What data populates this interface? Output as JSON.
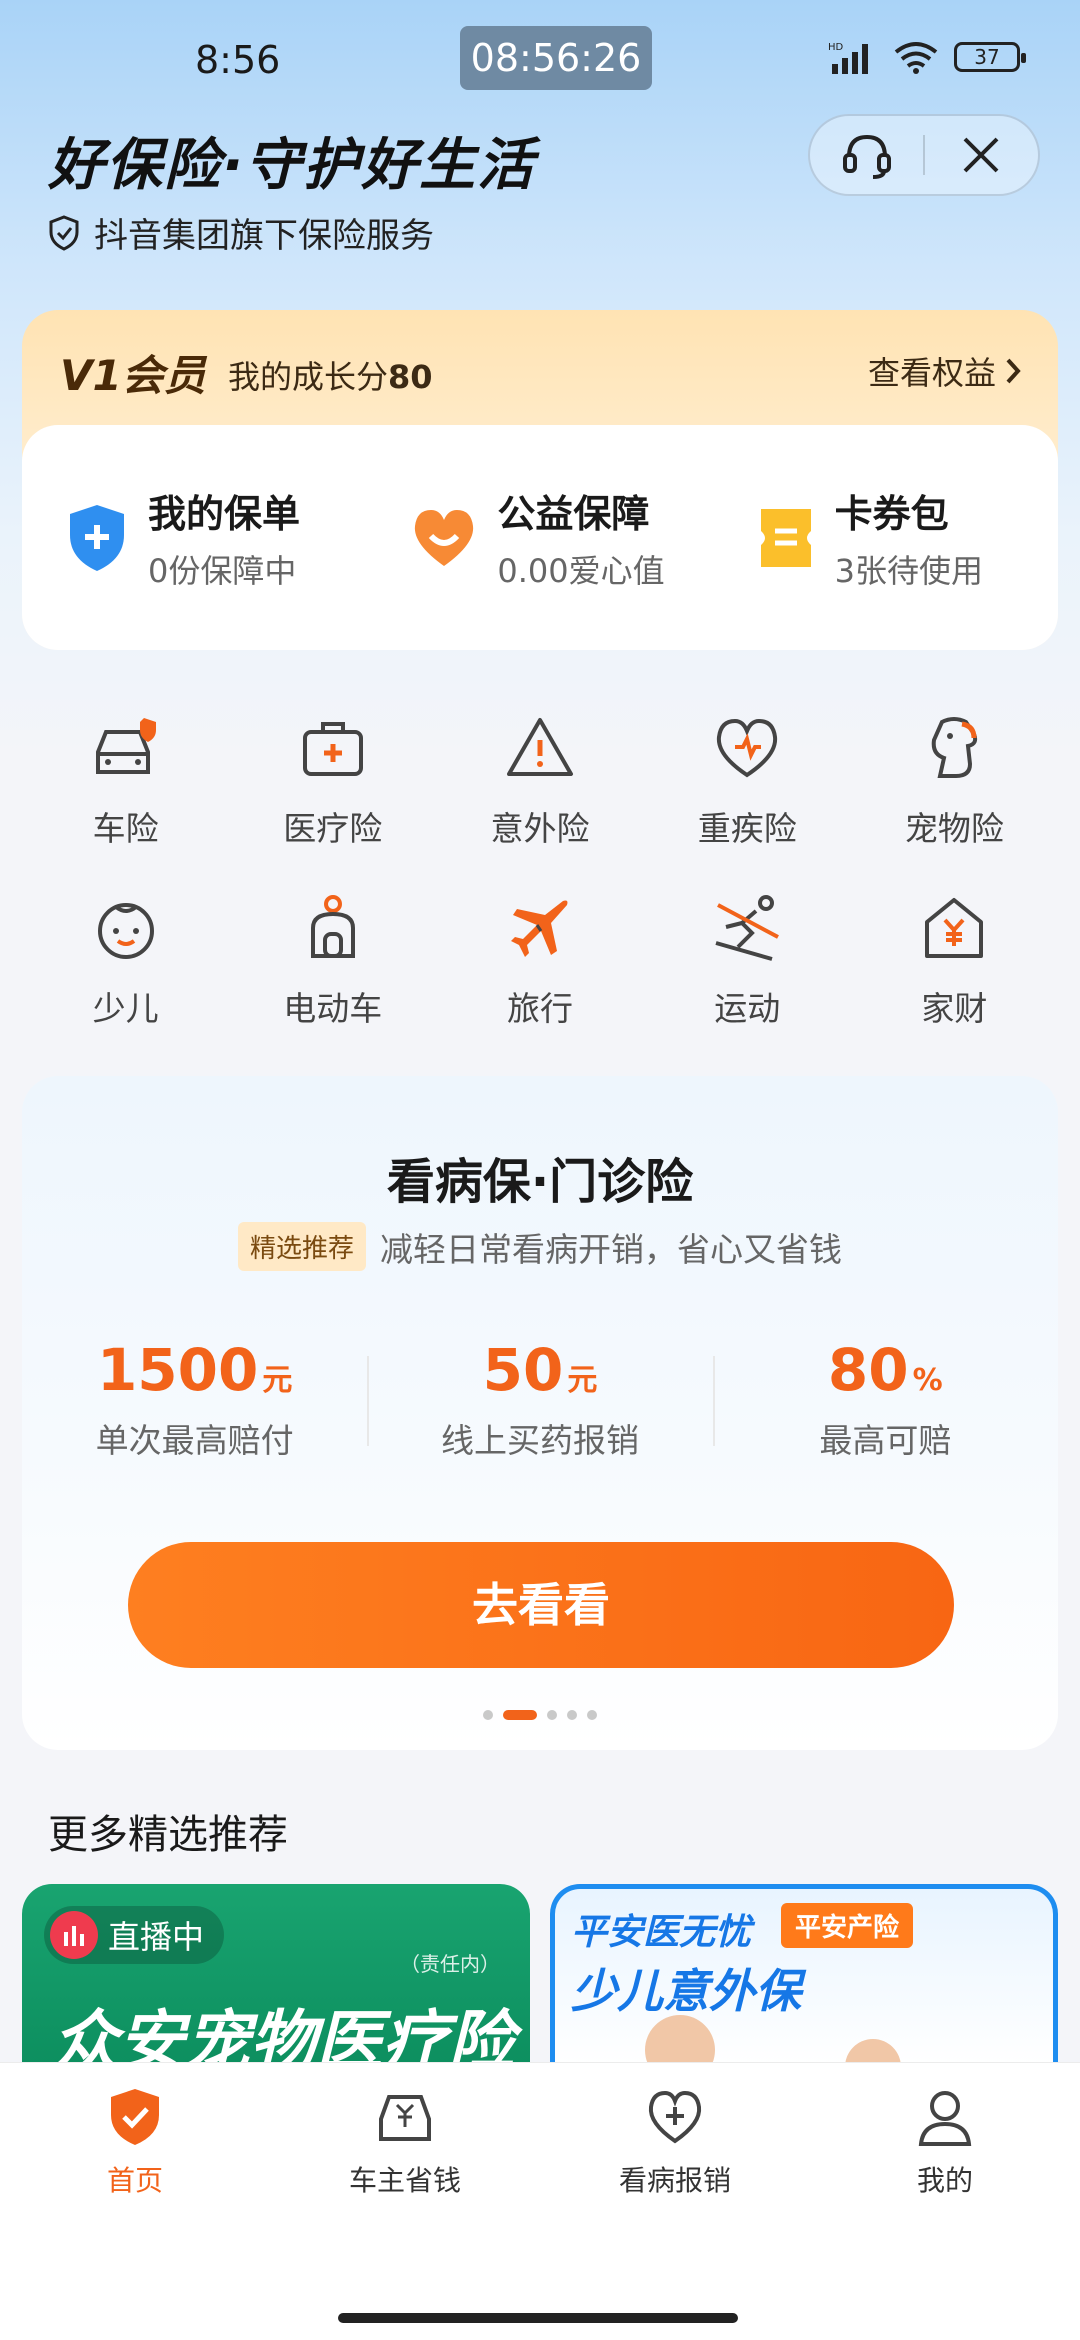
{
  "status_bar": {
    "time": "8:56",
    "clock": "08:56:26",
    "battery": "37"
  },
  "header": {
    "title": "好保险·守护好生活",
    "subtitle": "抖音集团旗下保险服务"
  },
  "member": {
    "level": "V1会员",
    "score_label": "我的成长分",
    "score": "80",
    "link": "查看权益"
  },
  "quick": [
    {
      "title": "我的保单",
      "sub": "0份保障中",
      "icon": "shield-plus-icon"
    },
    {
      "title": "公益保障",
      "sub": "0.00爱心值",
      "icon": "heart-smile-icon"
    },
    {
      "title": "卡券包",
      "sub": "3张待使用",
      "icon": "ticket-icon"
    }
  ],
  "categories": [
    {
      "label": "车险",
      "icon": "car-icon"
    },
    {
      "label": "医疗险",
      "icon": "medical-kit-icon"
    },
    {
      "label": "意外险",
      "icon": "warning-icon"
    },
    {
      "label": "重疾险",
      "icon": "heart-pulse-icon"
    },
    {
      "label": "宠物险",
      "icon": "pet-icon"
    },
    {
      "label": "少儿",
      "icon": "baby-icon"
    },
    {
      "label": "电动车",
      "icon": "scooter-icon"
    },
    {
      "label": "旅行",
      "icon": "plane-icon"
    },
    {
      "label": "运动",
      "icon": "ski-icon"
    },
    {
      "label": "家财",
      "icon": "house-yen-icon"
    }
  ],
  "feature": {
    "title": "看病保·门诊险",
    "tag": "精选推荐",
    "desc": "减轻日常看病开销，省心又省钱",
    "stats": [
      {
        "num": "1500",
        "unit": "元",
        "label": "单次最高赔付"
      },
      {
        "num": "50",
        "unit": "元",
        "label": "线上买药报销"
      },
      {
        "num": "80",
        "unit": "%",
        "label": "最高可赔"
      }
    ],
    "button": "去看看",
    "carousel_active": 2,
    "carousel_total": 5
  },
  "more": {
    "title": "更多精选推荐",
    "promo1": {
      "live": "直播中",
      "note": "（责任内）",
      "name": "众安宠物医疗险"
    },
    "promo2": {
      "brand": "平安医无忧",
      "org": "平安产险",
      "name": "少儿意外保"
    }
  },
  "nav": [
    {
      "label": "首页",
      "icon": "home-shield-icon",
      "active": true
    },
    {
      "label": "车主省钱",
      "icon": "car-yen-icon",
      "active": false
    },
    {
      "label": "看病报销",
      "icon": "heart-plus-icon",
      "active": false
    },
    {
      "label": "我的",
      "icon": "person-icon",
      "active": false
    }
  ],
  "colors": {
    "accent": "#f2631a",
    "member_bg": "#ffe3b3",
    "promo_green": "#19a470",
    "promo_blue": "#1e8df0"
  }
}
